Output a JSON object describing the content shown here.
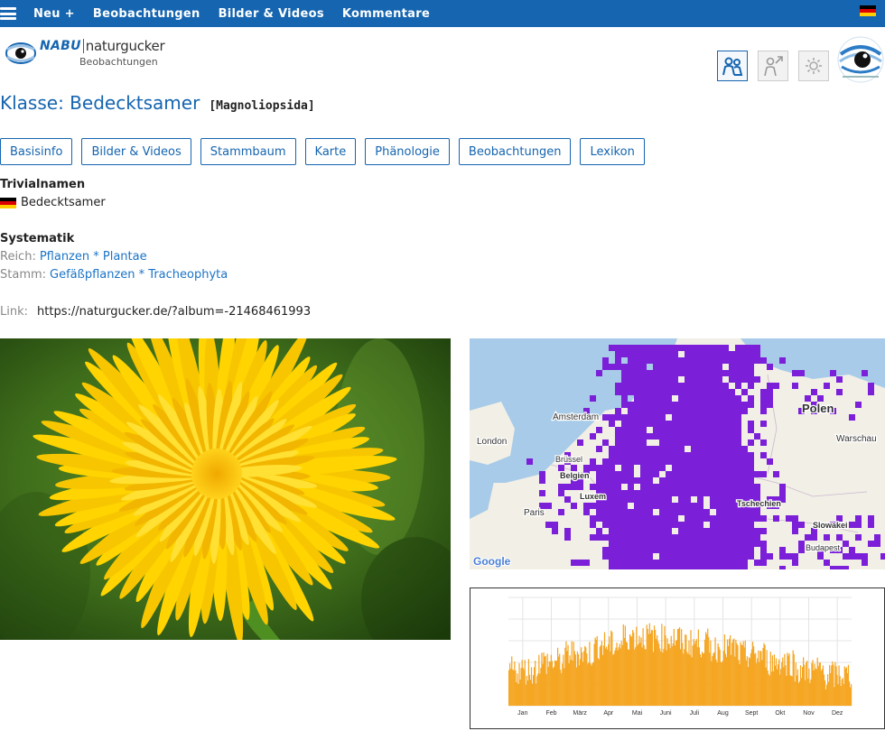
{
  "topbar": {
    "menu": [
      "Neu +",
      "Beobachtungen",
      "Bilder & Videos",
      "Kommentare"
    ]
  },
  "header": {
    "logo_nabu": "NABU",
    "logo_naturgucker": "naturgucker",
    "logo_sub": "Beobachtungen"
  },
  "page": {
    "title": "Klasse: Bedecktsamer",
    "scientific": "[Magnoliopsida]"
  },
  "tabs": [
    "Basisinfo",
    "Bilder & Videos",
    "Stammbaum",
    "Karte",
    "Phänologie",
    "Beobachtungen",
    "Lexikon"
  ],
  "trivial": {
    "heading": "Trivialnamen",
    "name": "Bedecktsamer"
  },
  "systematik": {
    "heading": "Systematik",
    "reich_label": "Reich:",
    "reich_value": "Pflanzen * Plantae",
    "stamm_label": "Stamm:",
    "stamm_value": "Gefäßpflanzen * Tracheophyta"
  },
  "link": {
    "label": "Link:",
    "url": "https://naturgucker.de/?album=-21468461993"
  },
  "map": {
    "labels": [
      "Amsterdam",
      "London",
      "Brüssel",
      "Belgien",
      "Luxem",
      "Paris",
      "Polen",
      "Warschau",
      "Tschechien",
      "Slowakei",
      "Budapest"
    ],
    "google": "Google"
  },
  "colors": {
    "primary": "#1565b0",
    "map_fill": "#7b1fd8",
    "chart_bar": "#f5a623"
  },
  "chart_data": {
    "type": "bar",
    "xlabel": "",
    "ylabel": "",
    "categories": [
      "Jan",
      "Feb",
      "März",
      "Apr",
      "Mai",
      "Juni",
      "Juli",
      "Aug",
      "Sept",
      "Okt",
      "Nov",
      "Dez"
    ],
    "monthly_level": [
      0.42,
      0.52,
      0.62,
      0.72,
      0.82,
      0.8,
      0.74,
      0.68,
      0.6,
      0.52,
      0.42,
      0.36
    ],
    "grid": true
  }
}
